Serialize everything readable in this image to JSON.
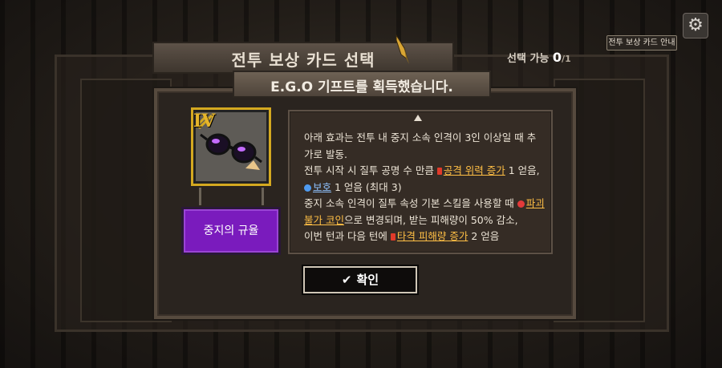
{
  "header": {
    "title": "전투 보상 카드 선택",
    "select_label": "선택 가능",
    "select_count": "0",
    "select_total": "/1",
    "guide_button": "전투 보상 카드 안내"
  },
  "dialog": {
    "subtitle": "E.G.O 기프트를 획득했습니다.",
    "gift": {
      "tier": "IV",
      "name": "중지의 규율"
    },
    "description": {
      "line1": "아래 효과는 전투 내 중지 소속 인격이 3인 이상일 때 추가로 발동.",
      "line2a": "전투 시작 시 질투 공명 수 만큼 ",
      "kw_attack": "공격 위력 증가",
      "line2b": " 1 얻음, ",
      "kw_protect": "보호",
      "line2c": " 1 얻음 (최대 3)",
      "line3a": "중지 소속 인격이 질투 속성 기본 스킬을 사용할 때 ",
      "kw_coin": "파괴 불가 코인",
      "line3b": "으로 변경되며, 받는 피해량이 50% 감소,",
      "line4a": "이번 턴과 다음 턴에 ",
      "kw_stagger": "타격 피해량 증가",
      "line4b": " 2 얻음"
    },
    "confirm_button": "확인"
  },
  "icons": [
    "gear-icon",
    "pen-nib-icon",
    "sunglasses-icon",
    "check-icon"
  ],
  "colors": {
    "accent_purple": "#7a1bbd",
    "keyword_orange": "#ffbf45",
    "keyword_blue": "#8fc2ff",
    "tier_gold": "#e6b52a"
  }
}
